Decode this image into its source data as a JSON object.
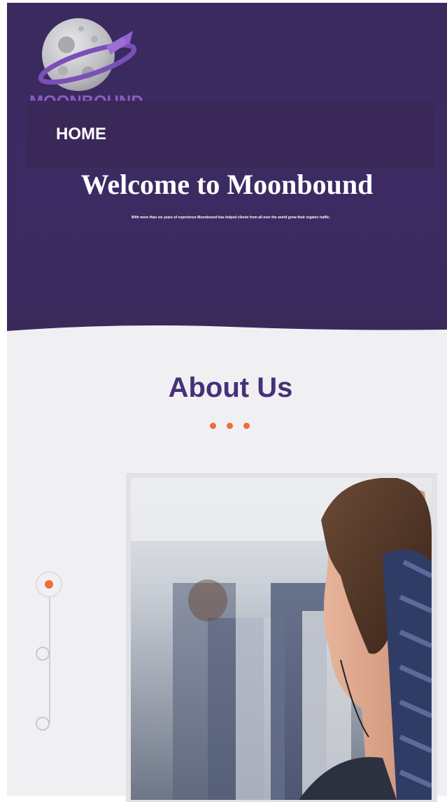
{
  "brand": {
    "name": "MOONBOUND"
  },
  "nav": {
    "home_label": "HOME"
  },
  "hero": {
    "title": "Welcome to Moonbound",
    "subtitle": "With more than six years of experience Moonbound has helped clients from all over the world grow their organic traffic."
  },
  "about": {
    "title": "About Us"
  },
  "timeline": {
    "active_index": 0,
    "count": 3
  },
  "colors": {
    "hero_bg": "#3a2a5e",
    "accent_orange": "#f26b3a",
    "heading_purple": "#47307a",
    "brand_purple": "#8a5cc4",
    "section_bg": "#f0f0f3"
  },
  "icons": {
    "logo": "moon-rocket-logo-icon",
    "timeline_active": "timeline-active-dot-icon",
    "timeline_inactive": "timeline-dot-icon"
  }
}
